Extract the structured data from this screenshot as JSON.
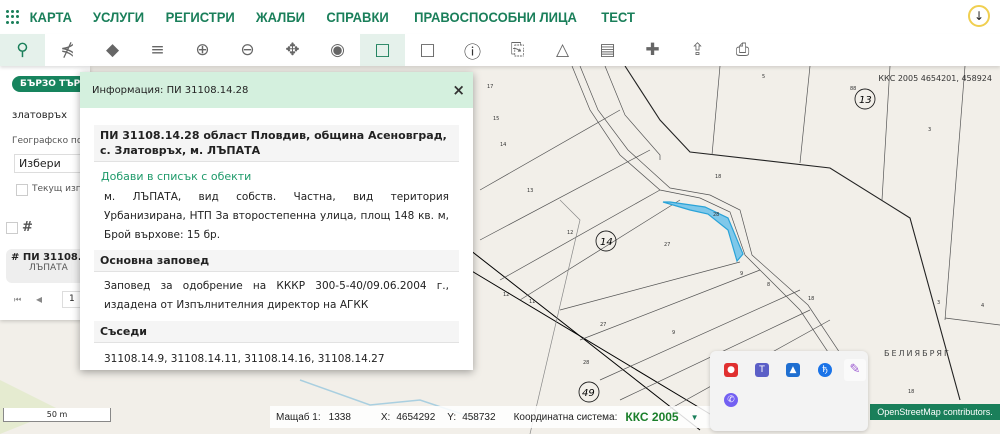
{
  "nav": {
    "items": [
      "КАРТА",
      "УСЛУГИ",
      "РЕГИСТРИ",
      "ЖАЛБИ",
      "СПРАВКИ",
      "ПРАВОСПОСОБНИ ЛИЦА",
      "ТЕСТ"
    ],
    "download_icon": "↓"
  },
  "toolbar": {
    "tools": [
      "search-icon",
      "topology-icon",
      "layers-filled-icon",
      "layers-icon",
      "zoom-in-icon",
      "zoom-out-icon",
      "pan-icon",
      "location-pin-icon",
      "select-rectangle-icon",
      "rectangle-clear-icon",
      "info-icon",
      "document-icon",
      "polygon-icon",
      "map-icon",
      "crosshair-icon",
      "export-icon",
      "print-icon"
    ],
    "active": [
      "search-icon",
      "select-rectangle-icon"
    ]
  },
  "left_panel": {
    "quick_search": "БЪРЗО ТЪРСЕНЕ",
    "search_value": "златовръх",
    "geo_label": "Географско положение",
    "geo_select": "Избери",
    "current_view": "Текущ изглед",
    "result_title": "ПИ 31108.14.28",
    "result_sub": "ЛЪПАТА",
    "page": "1"
  },
  "popup": {
    "title": "Информация: ПИ 31108.14.28",
    "close": "×",
    "heading": "ПИ 31108.14.28 област Пловдив, община Асеновград, с. Златовръх, м. ЛЪПАТА",
    "add_link": "Добави в списък с обекти",
    "description": "м. ЛЪПАТА, вид собств. Частна, вид територия Урбанизирана, НТП За второстепенна улица, площ 148 кв. м, Брой върхове: 15 бр.",
    "order_title": "Основна заповед",
    "order_text": "Заповед за одобрение на КККР 300-5-40/09.06.2004 г., издадена от Изпълнителния директор на АГКК",
    "neighbors_title": "Съседи",
    "neighbors": "31108.14.9, 31108.14.11, 31108.14.16, 31108.14.27"
  },
  "map": {
    "coord_readout": "ККС 2005 4654201, 458924",
    "locality": "БЕЛИЯБРЯГ",
    "blocks": [
      "13",
      "14",
      "49"
    ],
    "parcels": [
      "17",
      "15",
      "14",
      "13",
      "12",
      "12",
      "11",
      "27",
      "27",
      "28",
      "9",
      "9",
      "8",
      "18",
      "18",
      "5",
      "3",
      "3",
      "4",
      "88",
      "18",
      "28"
    ],
    "highlight_color": "#7fc8ea"
  },
  "status": {
    "scale_bar": "50 m",
    "scale_label": "Мащаб 1:",
    "scale_value": "1338",
    "x_label": "X:",
    "x_value": "4654292",
    "y_label": "Y:",
    "y_value": "458732",
    "crs_label": "Координатна система:",
    "crs_value": "ККС 2005"
  },
  "attribution": "OpenStreetMap contributors.",
  "tray": {
    "icons": [
      "screen-share-icon",
      "teams-icon",
      "defender-icon",
      "bluetooth-icon",
      "pen-icon",
      "viber-icon"
    ]
  }
}
